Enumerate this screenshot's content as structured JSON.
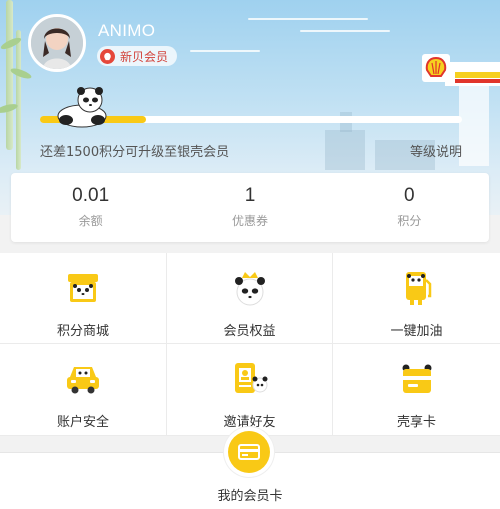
{
  "profile": {
    "username": "ANIMO",
    "member_level": "新贝会员"
  },
  "progress": {
    "fraction": 0.25,
    "upgrade_text": "还差1500积分可升级至银壳会员",
    "level_link": "等级说明"
  },
  "stats": [
    {
      "value": "0.01",
      "label": "余额"
    },
    {
      "value": "1",
      "label": "优惠券"
    },
    {
      "value": "0",
      "label": "积分"
    }
  ],
  "menu": [
    {
      "label": "积分商城",
      "icon": "shop-icon"
    },
    {
      "label": "会员权益",
      "icon": "crown-panda-icon"
    },
    {
      "label": "一键加油",
      "icon": "fuel-pump-icon"
    },
    {
      "label": "账户安全",
      "icon": "car-icon"
    },
    {
      "label": "邀请好友",
      "icon": "invite-icon"
    },
    {
      "label": "壳享卡",
      "icon": "card-icon"
    }
  ],
  "member_card": {
    "label": "我的会员卡"
  },
  "colors": {
    "accent": "#f9c916",
    "badge_red": "#e5483b"
  }
}
